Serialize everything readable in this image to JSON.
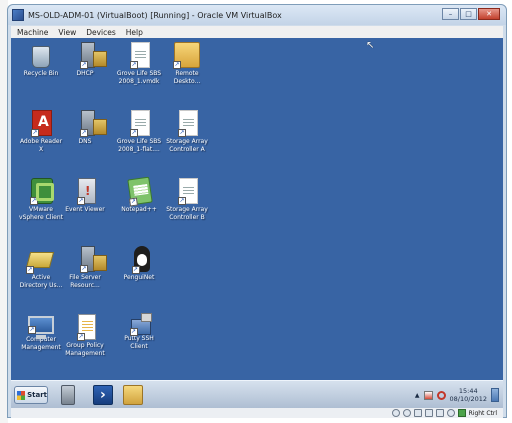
{
  "window": {
    "title": "MS-OLD-ADM-01 (VirtualBoot) [Running] - Oracle VM VirtualBox",
    "controls": {
      "minimize": "–",
      "maximize": "□",
      "close": "✕"
    }
  },
  "menu": [
    "Machine",
    "View",
    "Devices",
    "Help"
  ],
  "desktop_icons": [
    {
      "name": "recycle-bin",
      "label": "Recycle Bin",
      "icon": "recycle-bin-icon"
    },
    {
      "name": "dhcp",
      "label": "DHCP",
      "icon": "dhcp-icon"
    },
    {
      "name": "grove-life-vmdk",
      "label": "Grove Life SBS\n2008_1.vmdk",
      "icon": "file-icon"
    },
    {
      "name": "remote-desktop",
      "label": "Remote\nDeskto...",
      "icon": "folder-icon"
    },
    {
      "name": "adobe-reader",
      "label": "Adobe Reader\nX",
      "icon": "adobe-reader-icon"
    },
    {
      "name": "dns",
      "label": "DNS",
      "icon": "dns-icon"
    },
    {
      "name": "grove-life-flat",
      "label": "Grove Life SBS\n2008_1-flat....",
      "icon": "file-icon"
    },
    {
      "name": "storage-array-a",
      "label": "Storage Array\nController A",
      "icon": "document-icon"
    },
    {
      "name": "vmware-vsphere",
      "label": "VMware\nvSphere Client",
      "icon": "vmware-icon"
    },
    {
      "name": "event-viewer",
      "label": "Event Viewer",
      "icon": "event-viewer-icon"
    },
    {
      "name": "notepad-pp",
      "label": "Notepad++",
      "icon": "notepad-icon"
    },
    {
      "name": "storage-array-b",
      "label": "Storage Array\nController B",
      "icon": "document-icon"
    },
    {
      "name": "active-directory",
      "label": "Active\nDirectory Us...",
      "icon": "active-directory-icon"
    },
    {
      "name": "file-server",
      "label": "File Server\nResourc...",
      "icon": "file-server-icon"
    },
    {
      "name": "penguinet",
      "label": "PenguiNet",
      "icon": "penguin-icon"
    },
    {
      "name": "computer-management",
      "label": "Computer\nManagement",
      "icon": "computer-icon"
    },
    {
      "name": "group-policy",
      "label": "Group Policy\nManagement",
      "icon": "group-policy-icon"
    },
    {
      "name": "putty-ssh",
      "label": "Putty SSH\nClient",
      "icon": "putty-icon"
    }
  ],
  "taskbar": {
    "start_label": "Start",
    "clock_time": "15:44",
    "clock_date": "08/10/2012"
  },
  "status_bar": {
    "host_key_label": "Right Ctrl"
  },
  "colors": {
    "desktop_background": "#3864a4",
    "taskbar": "#c6d4e5"
  }
}
